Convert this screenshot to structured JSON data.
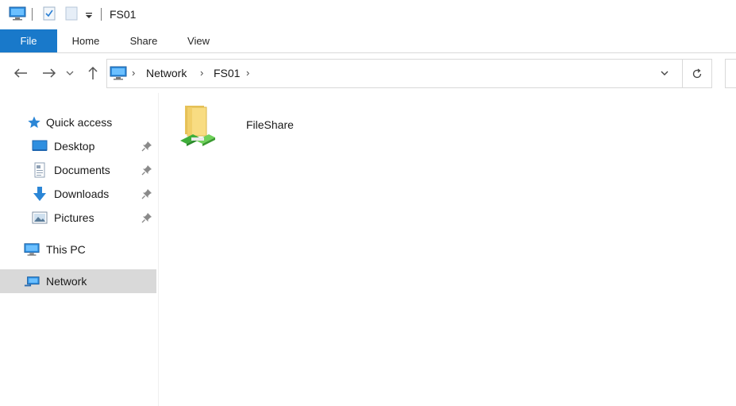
{
  "window": {
    "title": "FS01"
  },
  "ribbon": {
    "tabs": [
      {
        "label": "File"
      },
      {
        "label": "Home"
      },
      {
        "label": "Share"
      },
      {
        "label": "View"
      }
    ]
  },
  "address": {
    "crumbs": [
      "Network",
      "FS01"
    ]
  },
  "sidebar": {
    "items": [
      {
        "label": "Quick access",
        "icon": "star-icon"
      },
      {
        "label": "Desktop",
        "icon": "desktop-icon",
        "pinned": true
      },
      {
        "label": "Documents",
        "icon": "documents-icon",
        "pinned": true
      },
      {
        "label": "Downloads",
        "icon": "downloads-icon",
        "pinned": true
      },
      {
        "label": "Pictures",
        "icon": "pictures-icon",
        "pinned": true
      },
      {
        "label": "This PC",
        "icon": "this-pc-icon"
      },
      {
        "label": "Network",
        "icon": "network-icon",
        "selected": true
      }
    ]
  },
  "content": {
    "items": [
      {
        "label": "FileShare",
        "icon": "network-share-folder-icon"
      }
    ]
  },
  "colors": {
    "file_tab": "#1979ca",
    "selected_bg": "#d9d9d9"
  }
}
